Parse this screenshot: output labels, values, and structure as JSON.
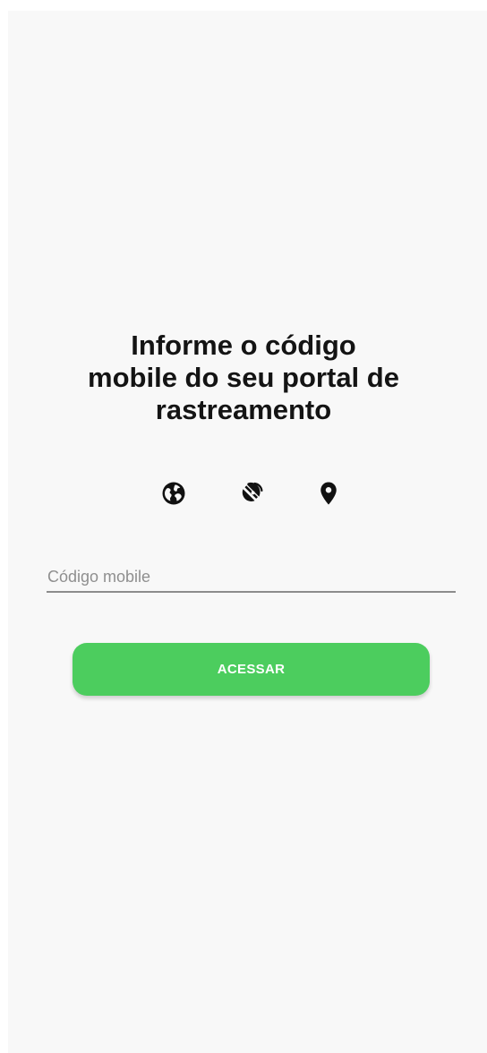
{
  "heading": {
    "line1": "Informe o código",
    "line2": "mobile do seu portal de",
    "line3": "rastreamento"
  },
  "icons": [
    "globe-icon",
    "satellite-dish-icon",
    "location-pin-icon"
  ],
  "form": {
    "code_placeholder": "Código mobile",
    "code_value": ""
  },
  "actions": {
    "submit_label": "ACESSAR"
  },
  "colors": {
    "accent": "#4ccd5e",
    "background": "#f8f8f8",
    "text": "#141414"
  }
}
